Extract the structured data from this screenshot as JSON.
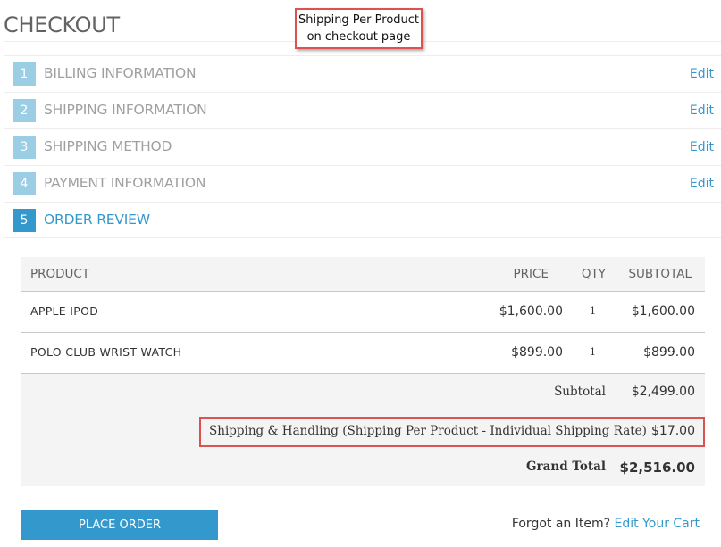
{
  "page": {
    "title": "CHECKOUT"
  },
  "callout": {
    "line1": "Shipping Per Product",
    "line2": "on checkout page"
  },
  "steps": [
    {
      "num": "1",
      "label": "BILLING INFORMATION",
      "edit": "Edit"
    },
    {
      "num": "2",
      "label": "SHIPPING INFORMATION",
      "edit": "Edit"
    },
    {
      "num": "3",
      "label": "SHIPPING METHOD",
      "edit": "Edit"
    },
    {
      "num": "4",
      "label": "PAYMENT INFORMATION",
      "edit": "Edit"
    },
    {
      "num": "5",
      "label": "ORDER REVIEW",
      "active": true
    }
  ],
  "review": {
    "headers": {
      "product": "PRODUCT",
      "price": "PRICE",
      "qty": "QTY",
      "subtotal": "SUBTOTAL"
    },
    "items": [
      {
        "name": "APPLE IPOD",
        "price": "$1,600.00",
        "qty": "1",
        "subtotal": "$1,600.00"
      },
      {
        "name": "POLO CLUB WRIST WATCH",
        "price": "$899.00",
        "qty": "1",
        "subtotal": "$899.00"
      }
    ],
    "totals": {
      "subtotal_label": "Subtotal",
      "subtotal_value": "$2,499.00",
      "shipping_label": "Shipping & Handling (Shipping Per Product - Individual Shipping Rate)",
      "shipping_value": "$17.00",
      "grand_label": "Grand Total",
      "grand_value": "$2,516.00"
    }
  },
  "footer": {
    "place_order": "PLACE ORDER",
    "forgot_text": "Forgot an Item?",
    "edit_cart": "Edit Your Cart"
  },
  "colors": {
    "accent": "#3399cc",
    "step_inactive": "#9bcde5",
    "highlight": "#d9534f"
  }
}
